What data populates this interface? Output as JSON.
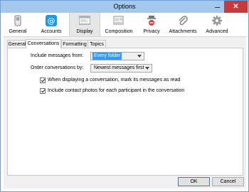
{
  "window": {
    "title": "Options"
  },
  "toolbar": {
    "items": [
      {
        "label": "General",
        "icon": "switch-icon"
      },
      {
        "label": "Accounts",
        "icon": "at-sign-icon"
      },
      {
        "label": "Display",
        "icon": "monitor-icon"
      },
      {
        "label": "Composition",
        "icon": "composition-icon"
      },
      {
        "label": "Privacy",
        "icon": "privacy-icon"
      },
      {
        "label": "Attachments",
        "icon": "paperclip-icon"
      },
      {
        "label": "Advanced",
        "icon": "gear-icon"
      }
    ],
    "selected": "Display"
  },
  "tabs": [
    "General",
    "Conversations",
    "Formatting",
    "Topics"
  ],
  "active_tab": "Conversations",
  "conversations": {
    "include_label": "Include messages from:",
    "include_value": "Every folder",
    "order_label": "Order conversations by:",
    "order_value": "Newest messages first",
    "mark_read_label": "When displaying a conversation, mark its messages as read",
    "mark_read_checked": true,
    "contact_photos_label": "Include contact photos for each participant in the conversation",
    "contact_photos_checked": true
  },
  "buttons": {
    "ok": "OK",
    "cancel": "Cancel"
  },
  "colors": {
    "accent": "#1e9be0",
    "selection": "#3399ff",
    "close": "#c7393a",
    "titlebar": "#a4c8ec"
  }
}
